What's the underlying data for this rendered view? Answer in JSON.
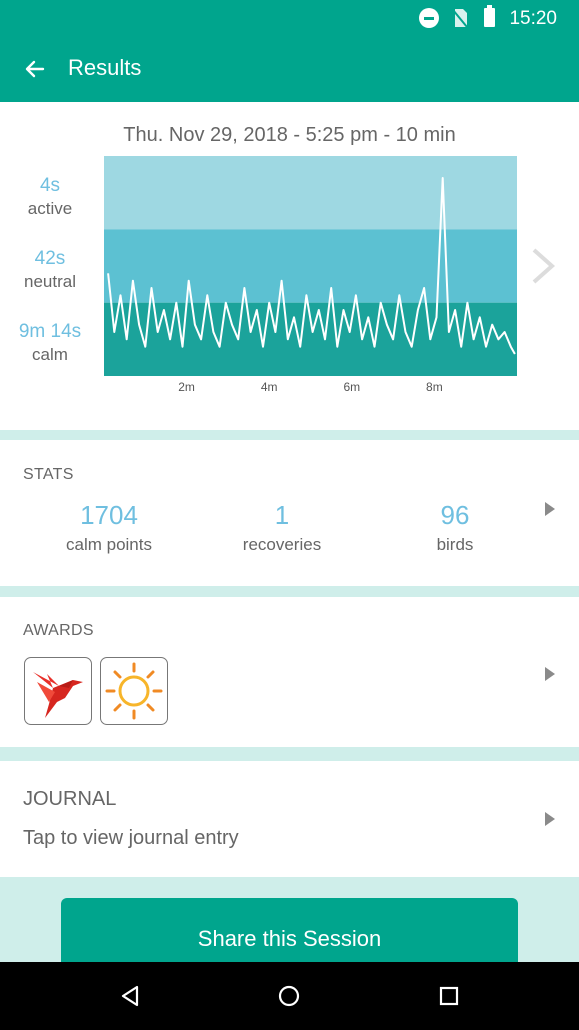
{
  "status": {
    "time": "15:20",
    "icons": [
      "do-not-disturb-icon",
      "no-sim-icon",
      "battery-icon"
    ]
  },
  "appbar": {
    "title": "Results",
    "back_icon": "arrow-left-icon"
  },
  "session": {
    "date": "Thu. Nov 29, 2018 - 5:25 pm - 10 min",
    "levels": [
      {
        "value": "4s",
        "label": "active"
      },
      {
        "value": "42s",
        "label": "neutral"
      },
      {
        "value": "9m 14s",
        "label": "calm"
      }
    ],
    "chart_data": {
      "type": "line",
      "x_ticks": [
        "2m",
        "4m",
        "6m",
        "8m"
      ],
      "bands": [
        "active",
        "neutral",
        "calm"
      ],
      "band_colors": [
        "#9ed8e2",
        "#5cc1d2",
        "#1ba39b"
      ],
      "xlim": [
        0,
        10
      ],
      "ylim": [
        0,
        3
      ],
      "series": [
        {
          "x": [
            0.1,
            0.25,
            0.4,
            0.55,
            0.7,
            0.85,
            1.0,
            1.15,
            1.3,
            1.45,
            1.6,
            1.75,
            1.9,
            2.05,
            2.2,
            2.35,
            2.5,
            2.65,
            2.8,
            2.95,
            3.1,
            3.25,
            3.4,
            3.55,
            3.7,
            3.85,
            4.0,
            4.15,
            4.3,
            4.45,
            4.6,
            4.75,
            4.9,
            5.05,
            5.2,
            5.35,
            5.5,
            5.65,
            5.8,
            5.95,
            6.1,
            6.25,
            6.4,
            6.55,
            6.7,
            6.85,
            7.0,
            7.15,
            7.3,
            7.45,
            7.6,
            7.75,
            7.9,
            8.05,
            8.2,
            8.35,
            8.5,
            8.65,
            8.8,
            8.95,
            9.1,
            9.25,
            9.4,
            9.55,
            9.7,
            9.85,
            9.95
          ],
          "y": [
            1.4,
            0.6,
            1.1,
            0.5,
            1.3,
            0.7,
            0.4,
            1.2,
            0.6,
            0.9,
            0.5,
            1.0,
            0.4,
            1.3,
            0.7,
            0.5,
            1.1,
            0.6,
            0.4,
            1.0,
            0.7,
            0.5,
            1.2,
            0.6,
            0.9,
            0.4,
            1.0,
            0.6,
            1.3,
            0.5,
            0.8,
            0.4,
            1.1,
            0.6,
            0.9,
            0.5,
            1.2,
            0.4,
            0.9,
            0.6,
            1.1,
            0.5,
            0.8,
            0.4,
            1.0,
            0.7,
            0.5,
            1.1,
            0.6,
            0.4,
            0.9,
            1.2,
            0.5,
            0.8,
            2.7,
            0.6,
            0.9,
            0.4,
            1.0,
            0.5,
            0.8,
            0.4,
            0.7,
            0.5,
            0.6,
            0.4,
            0.3
          ]
        }
      ]
    }
  },
  "stats": {
    "title": "STATS",
    "items": [
      {
        "value": "1704",
        "label": "calm points"
      },
      {
        "value": "1",
        "label": "recoveries"
      },
      {
        "value": "96",
        "label": "birds"
      }
    ]
  },
  "awards": {
    "title": "AWARDS",
    "items": [
      "hummingbird-award-icon",
      "sun-award-icon"
    ]
  },
  "journal": {
    "title": "JOURNAL",
    "subtitle": "Tap to view journal entry"
  },
  "share": {
    "label": "Share this Session"
  },
  "nav": {
    "icons": [
      "back-triangle-icon",
      "home-circle-icon",
      "recents-square-icon"
    ]
  }
}
